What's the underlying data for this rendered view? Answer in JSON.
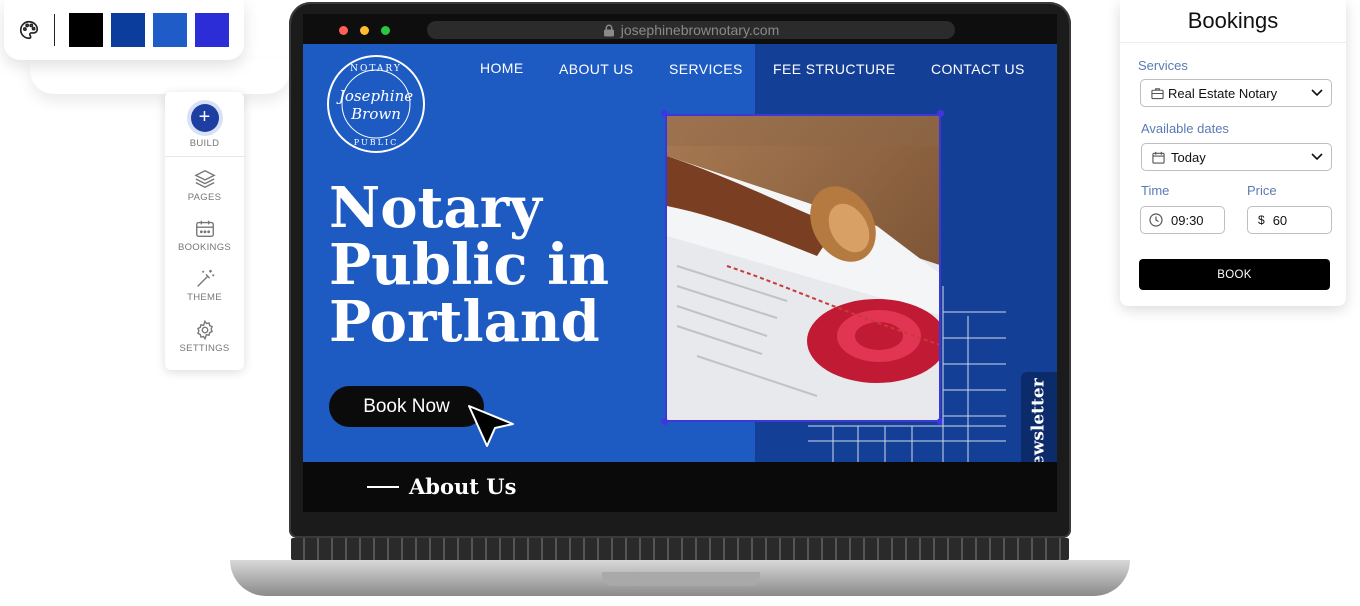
{
  "palette": {
    "colors": [
      "#000000",
      "#0a3d9c",
      "#1f5cc8",
      "#2c2dd6"
    ]
  },
  "toolbar": {
    "build": "BUILD",
    "pages": "PAGES",
    "bookings": "BOOKINGS",
    "theme": "THEME",
    "settings": "SETTINGS"
  },
  "browser": {
    "url": "josephinebrownotary.com"
  },
  "site": {
    "nav": [
      "HOME",
      "ABOUT US",
      "SERVICES",
      "FEE STRUCTURE",
      "CONTACT US"
    ],
    "logo": {
      "top": "NOTARY",
      "line1": "Josephine",
      "line2": "Brown",
      "bottom": "PUBLIC"
    },
    "hero_title": [
      "Notary",
      "Public in",
      "Portland"
    ],
    "cta": "Book Now",
    "newsletter": "Newsletter",
    "about": "About Us",
    "accent": "#1d5bc3",
    "accent_dark": "#143f96"
  },
  "bookings": {
    "title": "Bookings",
    "services_label": "Services",
    "service_value": "Real Estate Notary",
    "dates_label": "Available dates",
    "date_value": "Today",
    "time_label": "Time",
    "time_value": "09:30",
    "price_label": "Price",
    "currency": "$",
    "price_value": "60",
    "book": "BOOK"
  }
}
